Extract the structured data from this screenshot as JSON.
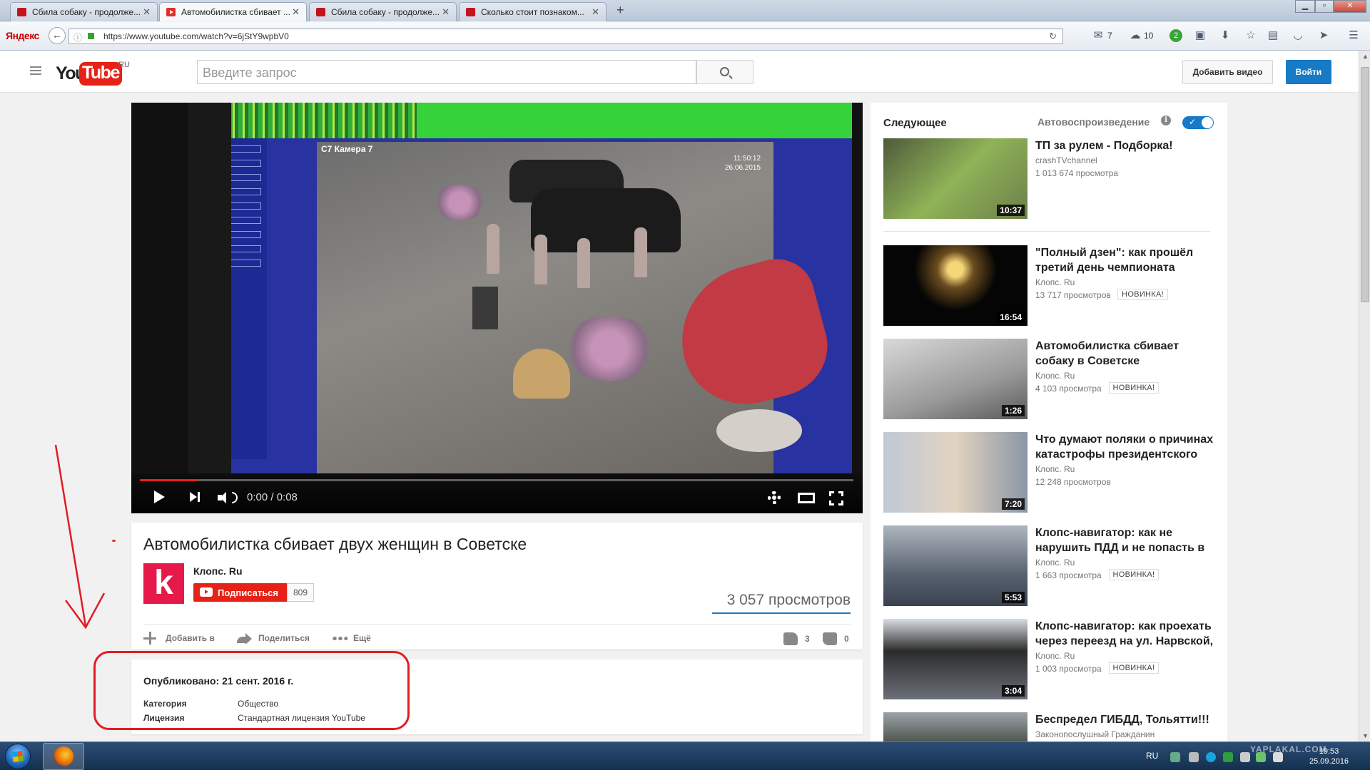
{
  "browser": {
    "tabs": [
      {
        "title": "Сбила собаку - продолже..."
      },
      {
        "title": "Автомобилистка сбивает ..."
      },
      {
        "title": "Сбила собаку - продолже..."
      },
      {
        "title": "Сколько стоит познаком..."
      }
    ],
    "brand": "Яндекс",
    "url": "https://www.youtube.com/watch?v=6jStY9wpbV0",
    "mail_count": "7",
    "weather": "10",
    "notif_count": "2"
  },
  "yt": {
    "logo_you": "You",
    "logo_tube": "Tube",
    "logo_region": "RU",
    "search_placeholder": "Введите запрос",
    "upload_label": "Добавить видео",
    "signin_label": "Войти"
  },
  "player": {
    "overlay_camera": "C7 Камера 7",
    "overlay_time": "11:50:12",
    "overlay_date": "26.06.2015",
    "time_display": "0:00 / 0:08",
    "progress": 0.08
  },
  "video": {
    "title": "Автомобилистка сбивает двух женщин в Советске",
    "channel_logo_letter": "k",
    "channel": "Клопс. Ru",
    "subscribe_label": "Подписаться",
    "subscriber_count": "809",
    "views": "3 057 просмотров",
    "actions": {
      "add": "Добавить в",
      "share": "Поделиться",
      "more": "Ещё"
    },
    "likes": "3",
    "dislikes": "0",
    "published": "Опубликовано: 21 сент. 2016 г.",
    "meta": [
      {
        "label": "Категория",
        "value": "Общество"
      },
      {
        "label": "Лицензия",
        "value": "Стандартная лицензия YouTube"
      }
    ]
  },
  "sidebar": {
    "heading": "Следующее",
    "autoplay_label": "Автовоспроизведение",
    "autoplay_on": true,
    "new_badge": "НОВИНКА!",
    "videos": [
      {
        "title": "ТП за рулем - Подборка!",
        "channel": "crashTVchannel",
        "views": "1 013 674 просмотра",
        "duration": "10:37",
        "is_new": false
      },
      {
        "title": "\"Полный дзен\": как прошёл третий день чемпионата",
        "channel": "Клопс. Ru",
        "views": "13 717 просмотров",
        "duration": "16:54",
        "is_new": true
      },
      {
        "title": "Автомобилистка сбивает собаку в Советске",
        "channel": "Клопс. Ru",
        "views": "4 103 просмотра",
        "duration": "1:26",
        "is_new": true
      },
      {
        "title": "Что думают поляки о причинах катастрофы президентского",
        "channel": "Клопс. Ru",
        "views": "12 248 просмотров",
        "duration": "7:20",
        "is_new": false
      },
      {
        "title": "Клопс-навигатор: как не нарушить ПДД и не попасть в",
        "channel": "Клопс. Ru",
        "views": "1 663 просмотра",
        "duration": "5:53",
        "is_new": true
      },
      {
        "title": "Клопс-навигатор: как проехать через переезд на ул. Нарвской,",
        "channel": "Клопс. Ru",
        "views": "1 003 просмотра",
        "duration": "3:04",
        "is_new": true
      },
      {
        "title": "Беспредел ГИБДД, Тольятти!!!",
        "channel": "Законопослушный Гражданин",
        "views": "",
        "duration": "",
        "is_new": false
      }
    ]
  },
  "taskbar": {
    "lang": "RU",
    "time": "19:53",
    "date": "25.09.2016"
  },
  "watermark": "YAPLAKAL.COM",
  "colors": {
    "yt_red": "#e62117",
    "yt_blue": "#167ac6",
    "annotation_red": "#e31b23"
  }
}
